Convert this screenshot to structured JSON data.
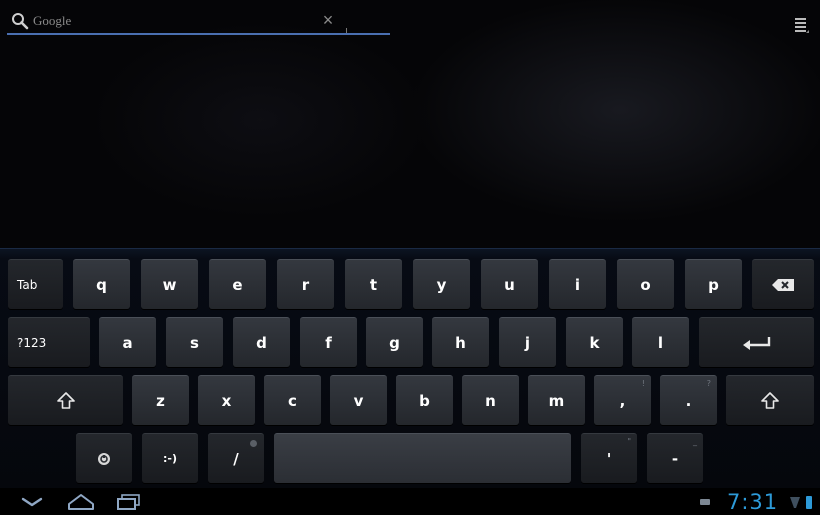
{
  "search": {
    "placeholder": "Google"
  },
  "keyboard": {
    "row1": {
      "tab": "Tab",
      "letters": [
        "q",
        "w",
        "e",
        "r",
        "t",
        "y",
        "u",
        "i",
        "o",
        "p"
      ]
    },
    "row2": {
      "mode": "?123",
      "letters": [
        "a",
        "s",
        "d",
        "f",
        "g",
        "h",
        "j",
        "k",
        "l"
      ]
    },
    "row3": {
      "letters": [
        "z",
        "x",
        "c",
        "v",
        "b",
        "n",
        "m"
      ],
      "comma": ",",
      "comma_hint": "!",
      "period": ".",
      "period_hint": "?"
    },
    "row4": {
      "smiley": ":-)",
      "slash": "/",
      "apostrophe": "'",
      "apostrophe_hint": "\"",
      "dash": "-",
      "dash_hint": "_"
    }
  },
  "status": {
    "time": "7:31"
  },
  "icons": {
    "search": "search-icon",
    "clear": "close-icon",
    "menu": "menu-icon",
    "backspace": "backspace-icon",
    "enter": "enter-icon",
    "shift": "shift-icon",
    "settings": "settings-icon",
    "back": "back-icon",
    "home": "home-icon",
    "recents": "recent-apps-icon",
    "notification": "notification-icon",
    "wifi": "wifi-icon",
    "battery": "battery-icon"
  },
  "colors": {
    "accent": "#2d9ad8",
    "search_underline": "#4a6fb0",
    "key_face": "#2e3137",
    "keyboard_bg": "#070b14"
  }
}
